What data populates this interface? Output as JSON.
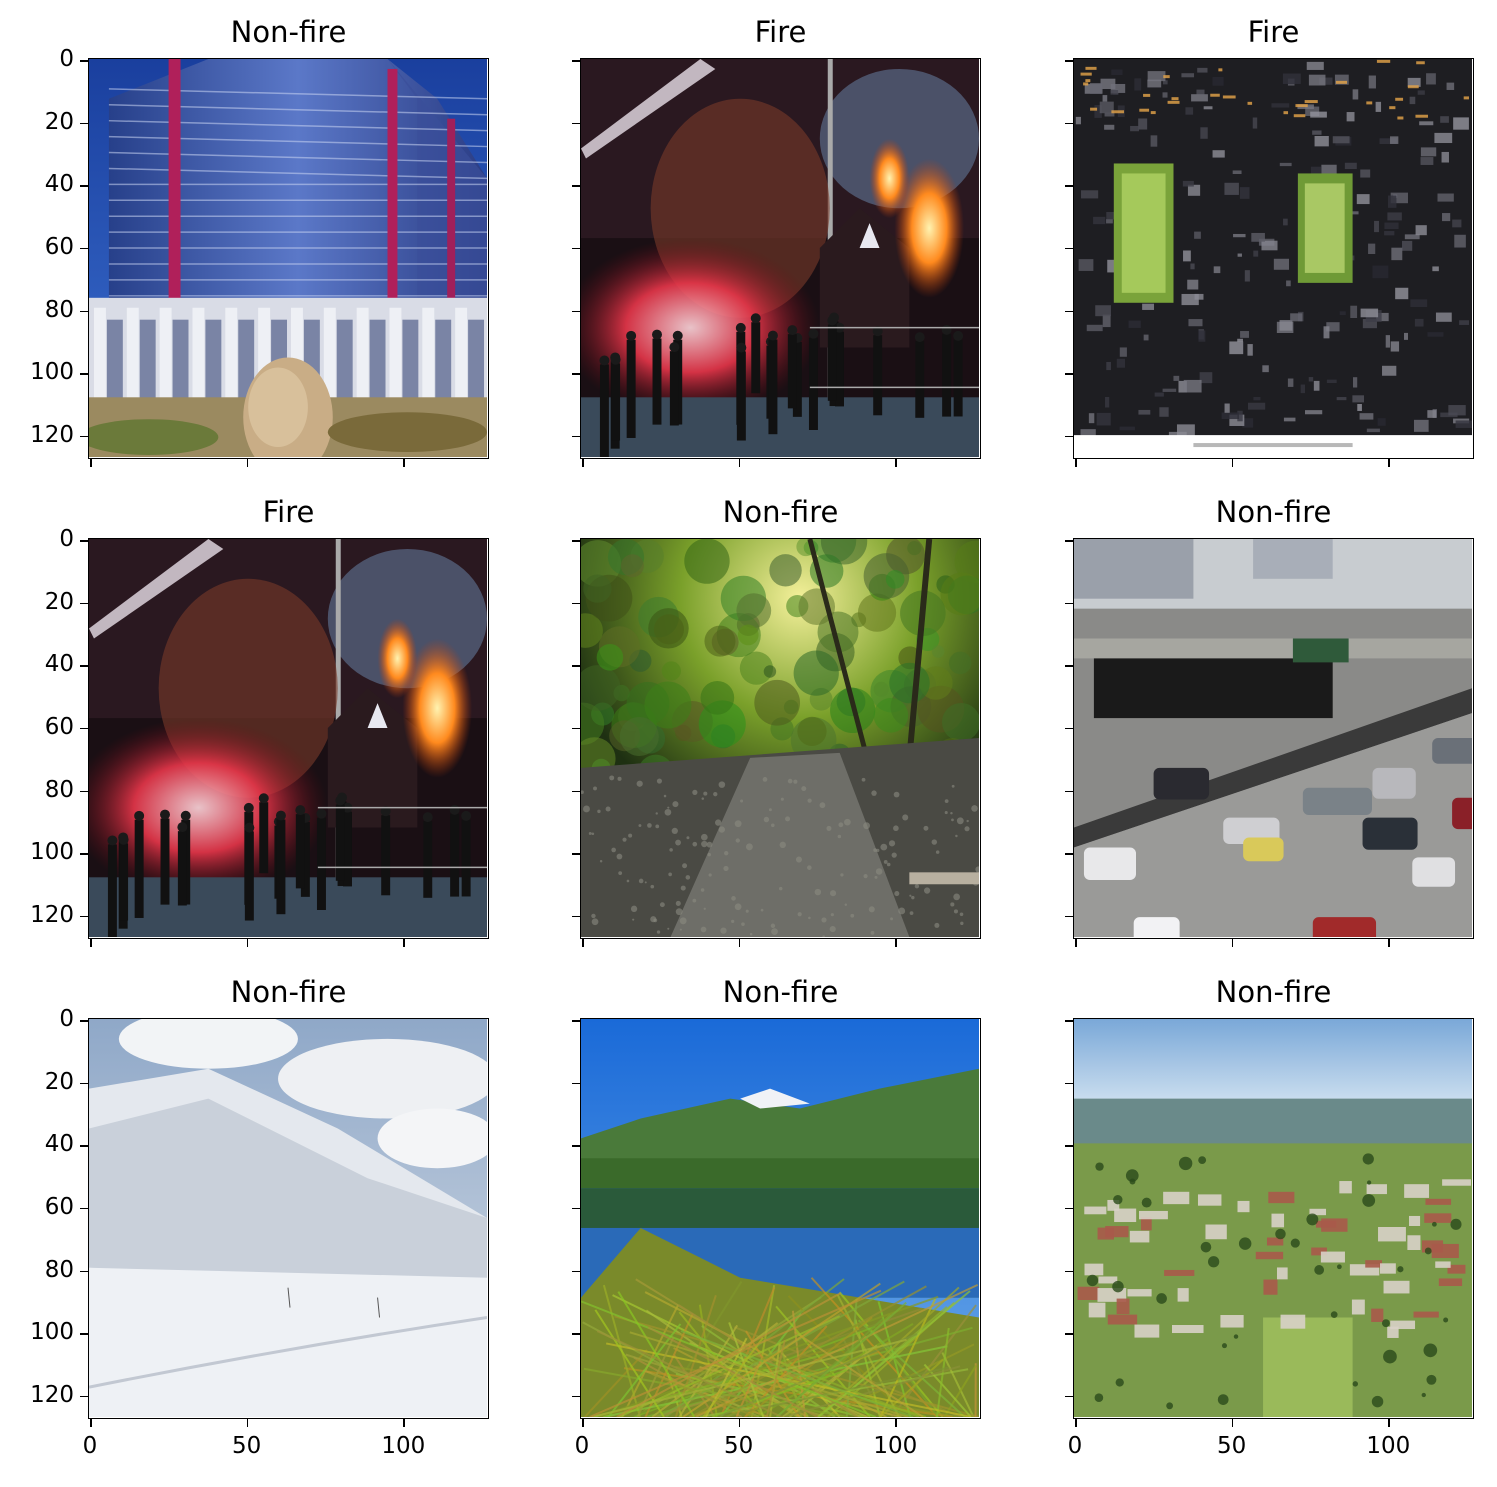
{
  "y_tick_labels": [
    "0",
    "20",
    "40",
    "60",
    "80",
    "100",
    "120"
  ],
  "x_tick_labels": [
    "0",
    "50",
    "100"
  ],
  "panels": [
    {
      "title": "Non-fire",
      "scene": "office-building"
    },
    {
      "title": "Fire",
      "scene": "house-fire-night"
    },
    {
      "title": "Fire",
      "scene": "burnt-interior"
    },
    {
      "title": "Fire",
      "scene": "house-fire-night"
    },
    {
      "title": "Non-fire",
      "scene": "forest-stream"
    },
    {
      "title": "Non-fire",
      "scene": "highway-traffic"
    },
    {
      "title": "Non-fire",
      "scene": "snowy-mountain"
    },
    {
      "title": "Non-fire",
      "scene": "mountain-lake"
    },
    {
      "title": "Non-fire",
      "scene": "aerial-town"
    }
  ]
}
